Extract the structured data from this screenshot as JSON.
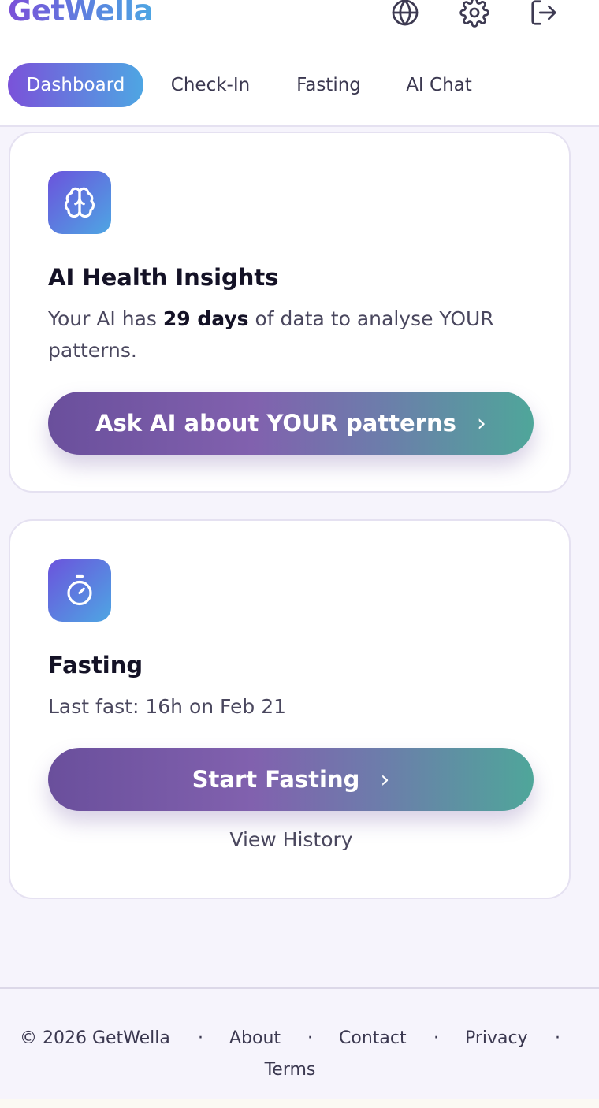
{
  "header": {
    "brand": "GetWella",
    "icons": [
      "globe-icon",
      "settings-gear-icon",
      "logout-icon"
    ]
  },
  "tabs": [
    {
      "label": "Dashboard",
      "active": true
    },
    {
      "label": "Check-In",
      "active": false
    },
    {
      "label": "Fasting",
      "active": false
    },
    {
      "label": "AI Chat",
      "active": false
    }
  ],
  "insights_card": {
    "icon": "brain-icon",
    "title": "AI Health Insights",
    "text_before": "Your AI has ",
    "days": "29 days",
    "text_after": " of data to analyse YOUR patterns.",
    "button_label": "Ask AI about YOUR patterns",
    "button_icon": "chevron-right-icon"
  },
  "fasting_card": {
    "icon": "stopwatch-icon",
    "title": "Fasting",
    "last_fast": "Last fast: 16h on Feb 21",
    "button_label": "Start Fasting",
    "button_icon": "chevron-right-icon",
    "history_link": "View History"
  },
  "footer": {
    "copyright": "© 2026 GetWella",
    "separator": "·",
    "links": [
      "About",
      "Contact",
      "Privacy",
      "Terms"
    ]
  },
  "colors": {
    "accent_purple": "#7a52d9",
    "accent_blue": "#4ea6e3",
    "cta_teal": "#4fa69a",
    "page_bg": "#f6f4fc"
  }
}
